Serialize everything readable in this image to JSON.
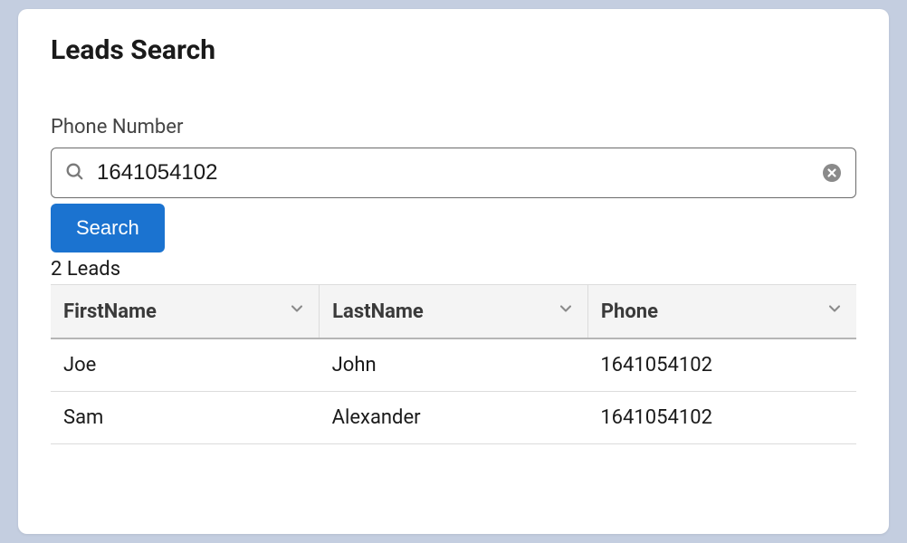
{
  "header": {
    "title": "Leads Search"
  },
  "search": {
    "field_label": "Phone Number",
    "value": "1641054102",
    "button_label": "Search"
  },
  "results": {
    "count_label": "2 Leads",
    "columns": {
      "first_name": "FirstName",
      "last_name": "LastName",
      "phone": "Phone"
    },
    "rows": [
      {
        "first_name": "Joe",
        "last_name": "John",
        "phone": "1641054102"
      },
      {
        "first_name": "Sam",
        "last_name": "Alexander",
        "phone": "1641054102"
      }
    ]
  }
}
